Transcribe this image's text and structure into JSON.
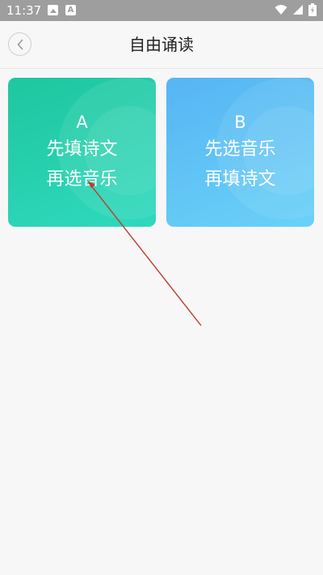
{
  "status_bar": {
    "time": "11:37",
    "left_icons": [
      "image-icon",
      "a-letter-icon"
    ],
    "right_icons": [
      "wifi-icon",
      "signal-icon",
      "battery-icon"
    ]
  },
  "header": {
    "back_icon": "chevron-left-icon",
    "title": "自由诵读"
  },
  "options": [
    {
      "letter": "A",
      "line1": "先填诗文",
      "line2": "再选音乐",
      "color_start": "#1ec79e",
      "color_end": "#2fd9be"
    },
    {
      "letter": "B",
      "line1": "先选音乐",
      "line2": "再填诗文",
      "color_start": "#56b5f4",
      "color_end": "#6ad1f7"
    }
  ],
  "annotation": {
    "type": "arrow",
    "color": "#c0392b",
    "target": "option-a"
  }
}
